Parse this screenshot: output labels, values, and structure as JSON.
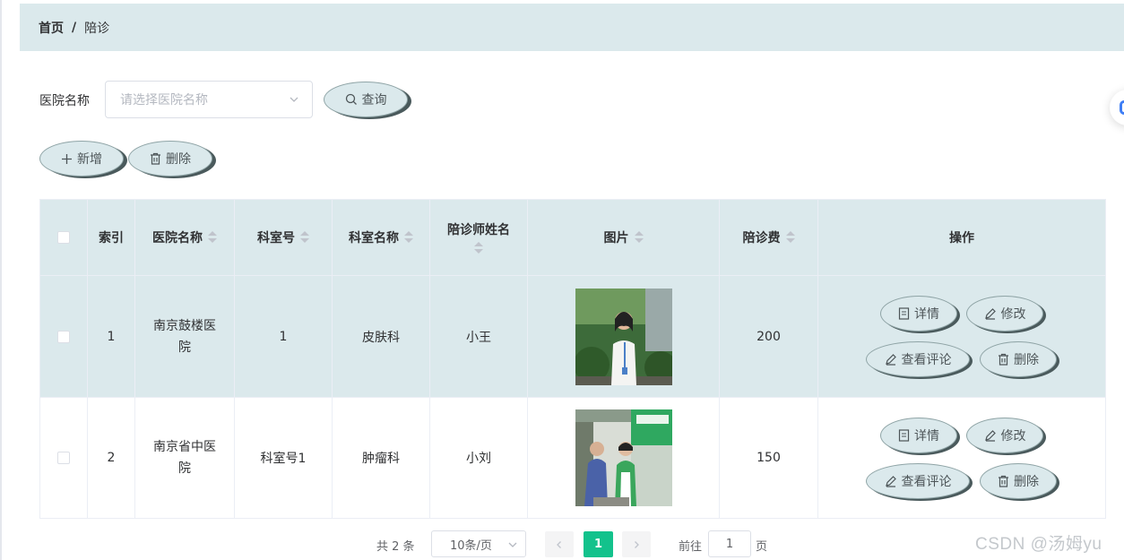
{
  "breadcrumb": {
    "home": "首页",
    "separator": "/",
    "current": "陪诊"
  },
  "filter": {
    "label": "医院名称",
    "placeholder": "请选择医院名称",
    "query_button": "查询"
  },
  "toolbar": {
    "add_button": "新增",
    "delete_button": "删除"
  },
  "table": {
    "headers": {
      "index": "索引",
      "hospital": "医院名称",
      "dept_no": "科室号",
      "dept_name": "科室名称",
      "escort_name": "陪诊师姓名",
      "image": "图片",
      "fee": "陪诊费",
      "actions": "操作"
    },
    "rows": [
      {
        "index": "1",
        "hospital": "南京鼓楼医院",
        "dept_no": "1",
        "dept_name": "皮肤科",
        "escort_name": "小王",
        "fee": "200"
      },
      {
        "index": "2",
        "hospital": "南京省中医院",
        "dept_no": "科室号1",
        "dept_name": "肿瘤科",
        "escort_name": "小刘",
        "fee": "150"
      }
    ],
    "actions": {
      "detail": "详情",
      "edit": "修改",
      "reviews": "查看评论",
      "delete": "删除"
    }
  },
  "pagination": {
    "total": "共 2 条",
    "page_size": "10条/页",
    "current_page": "1",
    "goto_label": "前往",
    "goto_value": "1",
    "page_suffix": "页"
  },
  "watermark": "CSDN @汤姆yu",
  "colors": {
    "header_bg": "#dbe9ec",
    "accent": "#13c28c",
    "pill_shadow": "#4a5a5c",
    "float_icon": "#3f7ef5"
  },
  "icons": {
    "search": "search-icon",
    "plus": "plus-icon",
    "trash": "trash-icon",
    "document": "document-icon",
    "pencil": "pencil-icon",
    "chevron": "chevron-down-icon"
  }
}
